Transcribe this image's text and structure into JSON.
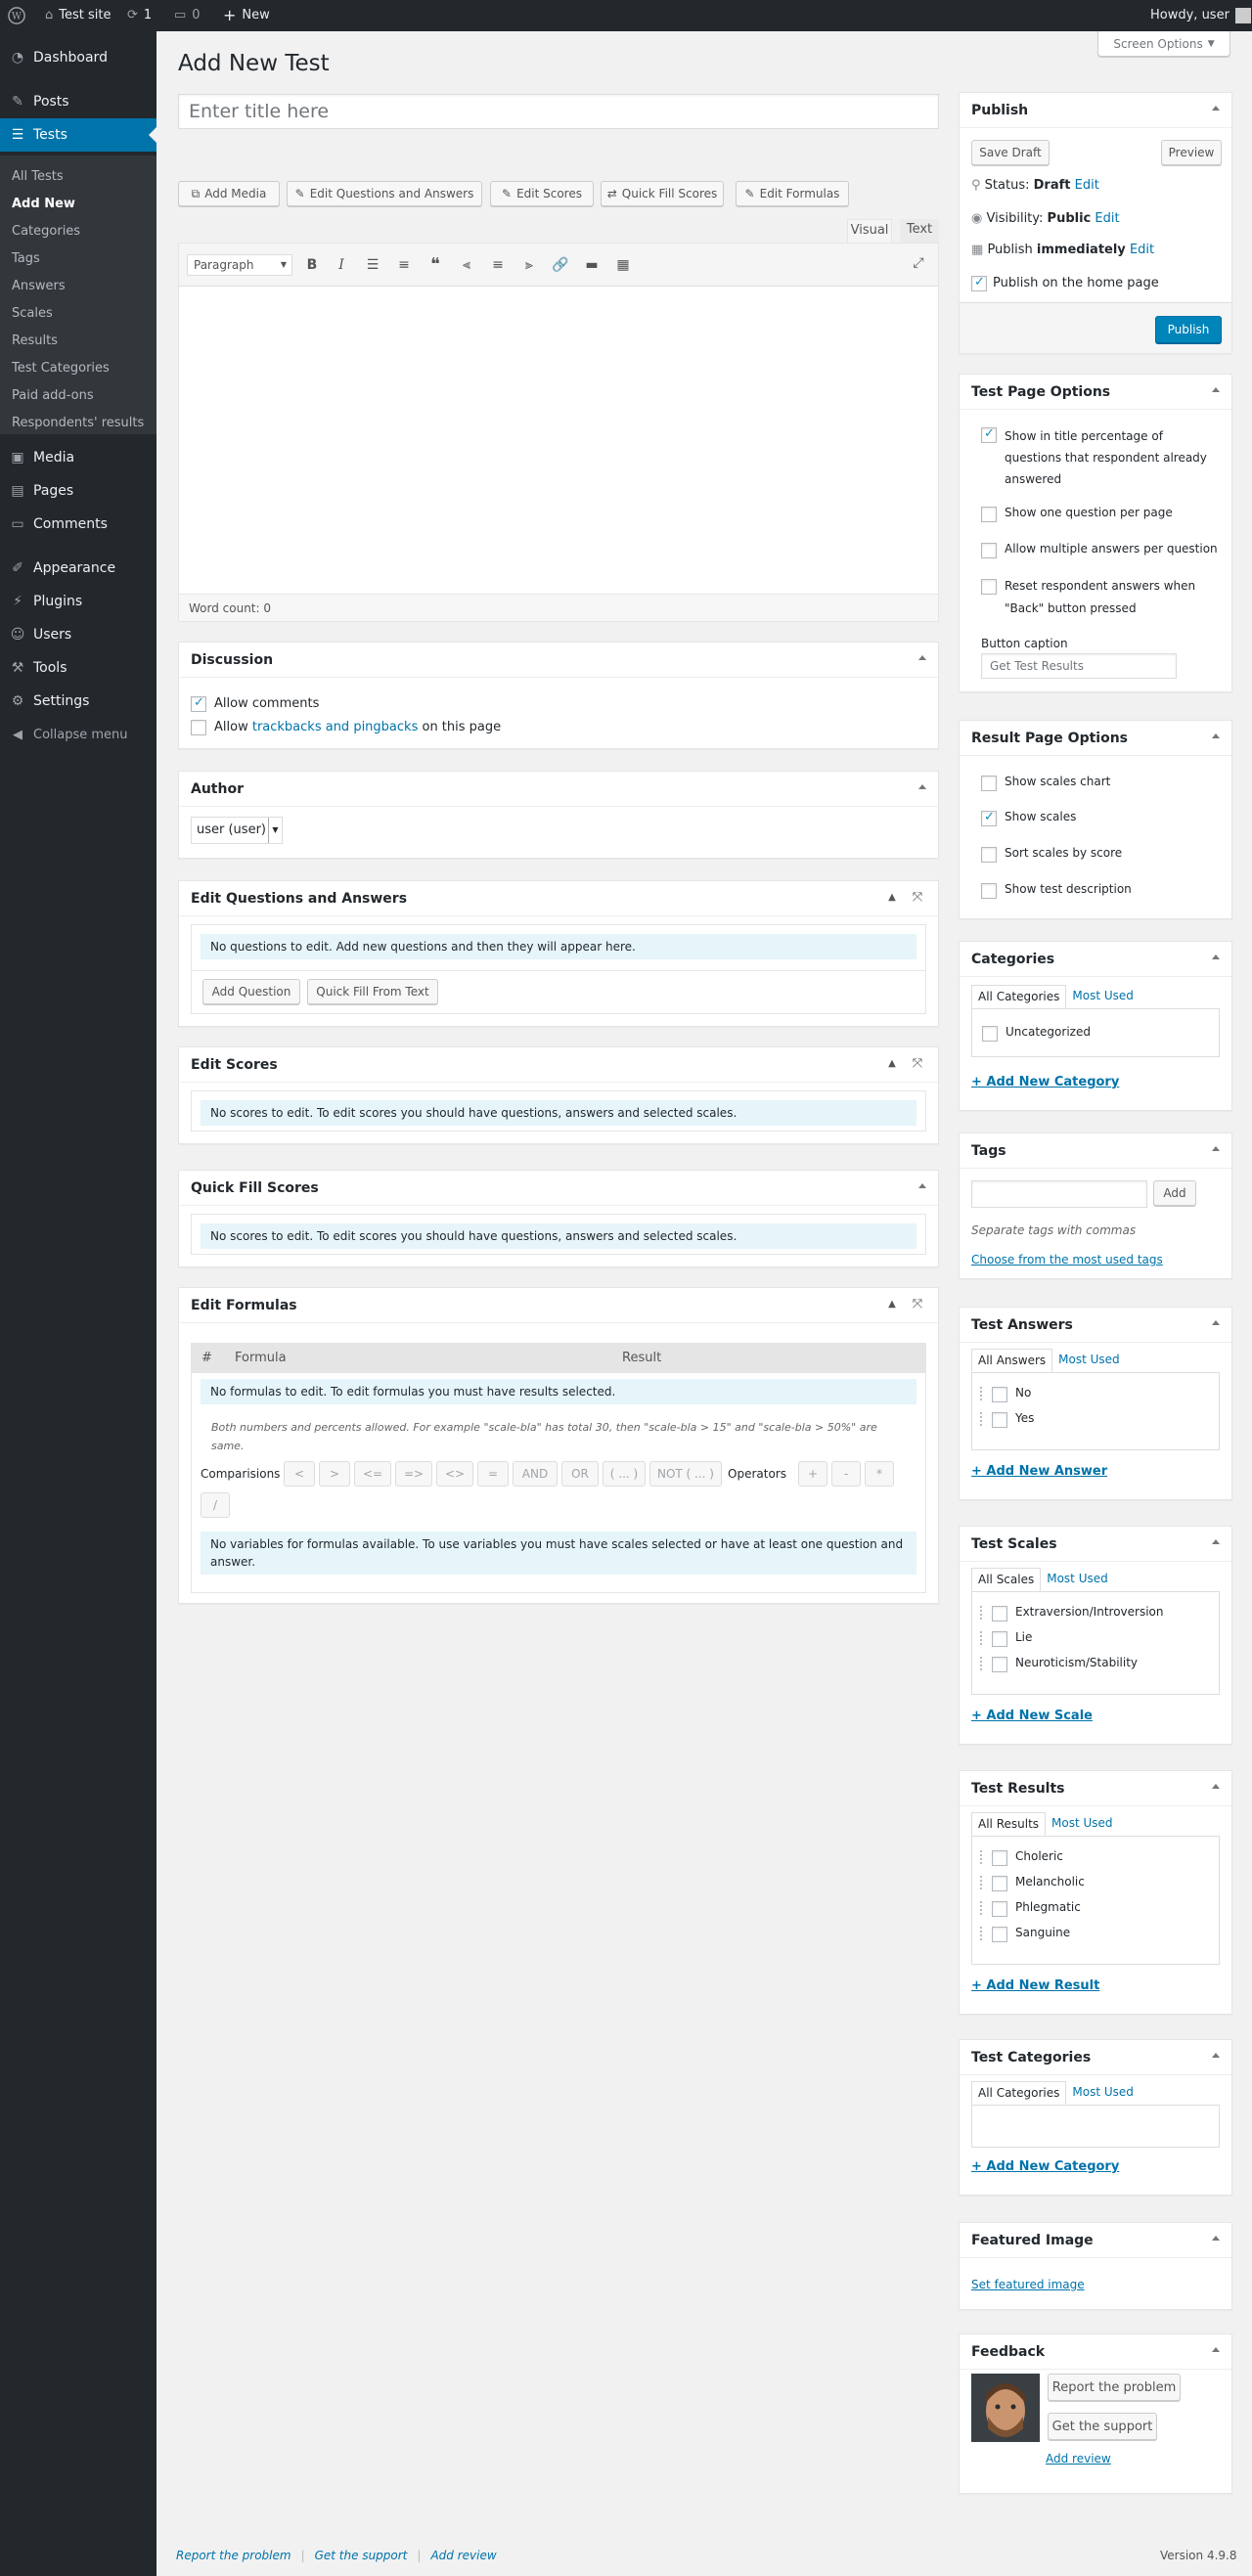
{
  "admin_bar": {
    "site_name": "Test site",
    "updates_count": "1",
    "comments_count": "0",
    "new_label": "New",
    "howdy": "Howdy, user"
  },
  "menu": {
    "dashboard": "Dashboard",
    "posts": "Posts",
    "tests": "Tests",
    "submenu": [
      "All Tests",
      "Add New",
      "Categories",
      "Tags",
      "Answers",
      "Scales",
      "Results",
      "Test Categories",
      "Paid add-ons",
      "Respondents' results"
    ],
    "media": "Media",
    "pages": "Pages",
    "comments": "Comments",
    "appearance": "Appearance",
    "plugins": "Plugins",
    "users": "Users",
    "tools": "Tools",
    "settings": "Settings",
    "collapse": "Collapse menu"
  },
  "screen_options": "Screen Options",
  "page_title": "Add New Test",
  "title_placeholder": "Enter title here",
  "media_buttons": {
    "add_media": "Add Media",
    "edit_qa": "Edit Questions and Answers",
    "edit_scores": "Edit Scores",
    "quick_fill": "Quick Fill Scores",
    "edit_formulas": "Edit Formulas"
  },
  "editor": {
    "tab_visual": "Visual",
    "tab_text": "Text",
    "format_select": "Paragraph",
    "word_count": "Word count: 0"
  },
  "discussion": {
    "title": "Discussion",
    "allow_comments": "Allow comments",
    "allow_prefix": "Allow",
    "trackbacks_link": "trackbacks and pingbacks",
    "allow_suffix": "on this page"
  },
  "author": {
    "title": "Author",
    "selected": "user (user)"
  },
  "edit_qa": {
    "title": "Edit Questions and Answers",
    "notice": "No questions to edit. Add new questions and then they will appear here.",
    "add_question": "Add Question",
    "quick_fill_text": "Quick Fill From Text"
  },
  "edit_scores": {
    "title": "Edit Scores",
    "notice": "No scores to edit. To edit scores you should have questions, answers and selected scales."
  },
  "quick_fill_scores": {
    "title": "Quick Fill Scores",
    "notice": "No scores to edit. To edit scores you should have questions, answers and selected scales."
  },
  "edit_formulas": {
    "title": "Edit Formulas",
    "col_hash": "#",
    "col_formula": "Formula",
    "col_result": "Result",
    "notice": "No formulas to edit. To edit formulas you must have results selected.",
    "hint_line1": "Both numbers and percents allowed. For example \"scale-bla\" has total 30, then \"scale-bla > 15\" and \"scale-bla > 50%\" are",
    "hint_line2": "same.",
    "comparisons_label": "Comparisions",
    "comparisons": [
      "<",
      ">",
      "<=",
      "=>",
      "<>",
      "=",
      "AND",
      "OR",
      "( ... )",
      "NOT ( ... )"
    ],
    "operators_label": "Operators",
    "operators": [
      "+",
      "-",
      "*",
      "/"
    ],
    "variables_notice_1": "No variables for formulas available. To use variables you must have scales selected or have at least one question and",
    "variables_notice_2": "answer."
  },
  "publish": {
    "title": "Publish",
    "save_draft": "Save Draft",
    "preview": "Preview",
    "status_label": "Status:",
    "status_value": "Draft",
    "visibility_label": "Visibility:",
    "visibility_value": "Public",
    "publish_label": "Publish",
    "publish_value": "immediately",
    "edit": "Edit",
    "home_page": "Publish on the home page",
    "publish_button": "Publish"
  },
  "test_page_options": {
    "title": "Test Page Options",
    "opt1_l1": "Show in title percentage of",
    "opt1_l2": "questions that respondent already",
    "opt1_l3": "answered",
    "opt2": "Show one question per page",
    "opt3": "Allow multiple answers per question",
    "opt4_l1": "Reset respondent answers when",
    "opt4_l2": "\"Back\" button pressed",
    "button_caption_label": "Button caption",
    "button_caption_placeholder": "Get Test Results"
  },
  "result_page_options": {
    "title": "Result Page Options",
    "opt1": "Show scales chart",
    "opt2": "Show scales",
    "opt3": "Sort scales by score",
    "opt4": "Show test description"
  },
  "categories": {
    "title": "Categories",
    "tab_all": "All Categories",
    "tab_most": "Most Used",
    "items": [
      "Uncategorized"
    ],
    "add_new": "+ Add New Category"
  },
  "tags": {
    "title": "Tags",
    "add": "Add",
    "hint": "Separate tags with commas",
    "choose": "Choose from the most used tags"
  },
  "test_answers": {
    "title": "Test Answers",
    "tab_all": "All Answers",
    "tab_most": "Most Used",
    "items": [
      "No",
      "Yes"
    ],
    "add_new": "+ Add New Answer"
  },
  "test_scales": {
    "title": "Test Scales",
    "tab_all": "All Scales",
    "tab_most": "Most Used",
    "items": [
      "Extraversion/Introversion",
      "Lie",
      "Neuroticism/Stability"
    ],
    "add_new": "+ Add New Scale"
  },
  "test_results": {
    "title": "Test Results",
    "tab_all": "All Results",
    "tab_most": "Most Used",
    "items": [
      "Choleric",
      "Melancholic",
      "Phlegmatic",
      "Sanguine"
    ],
    "add_new": "+ Add New Result"
  },
  "test_categories": {
    "title": "Test Categories",
    "tab_all": "All Categories",
    "tab_most": "Most Used",
    "add_new": "+ Add New Category"
  },
  "featured_image": {
    "title": "Featured Image",
    "link": "Set featured image"
  },
  "feedback": {
    "title": "Feedback",
    "report": "Report the problem",
    "support": "Get the support",
    "review": "Add review"
  },
  "footer": {
    "report": "Report the problem",
    "support": "Get the support",
    "review": "Add review",
    "version": "Version 4.9.8"
  },
  "colors": {
    "admin_dark": "#23282d",
    "accent": "#0073aa",
    "primary_button": "#0085ba"
  }
}
